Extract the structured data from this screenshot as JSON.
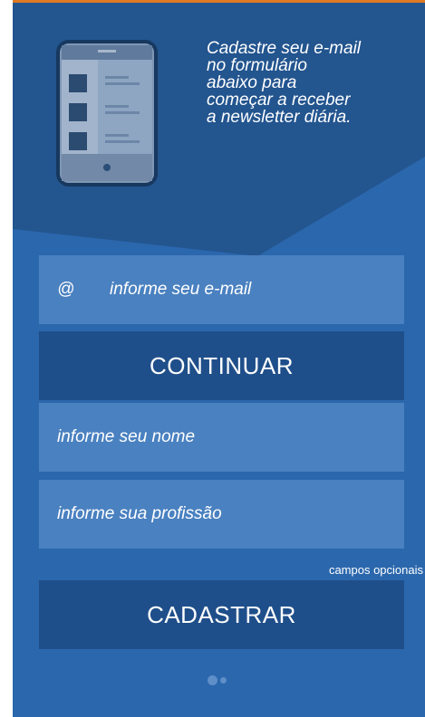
{
  "intro": {
    "lines": [
      "Cadastre seu e-mail",
      "no formulário",
      "abaixo para",
      "começar a receber",
      "a newsletter diária."
    ]
  },
  "email": {
    "symbol": "@",
    "placeholder": "informe seu e-mail"
  },
  "continue_label": "CONTINUAR",
  "name": {
    "placeholder": "informe seu nome"
  },
  "profession": {
    "placeholder": "informe sua profissão"
  },
  "optional_note": "campos opcionais",
  "submit_label": "CADASTRAR",
  "icons": {
    "device": "tablet-icon"
  },
  "colors": {
    "panel": "#2b67ad",
    "header_dark": "#23558f",
    "field": "#4a81c0",
    "button": "#1f4f8a",
    "accent": "#e07a22"
  },
  "carousel": {
    "dots": 2,
    "active_index": 0
  }
}
